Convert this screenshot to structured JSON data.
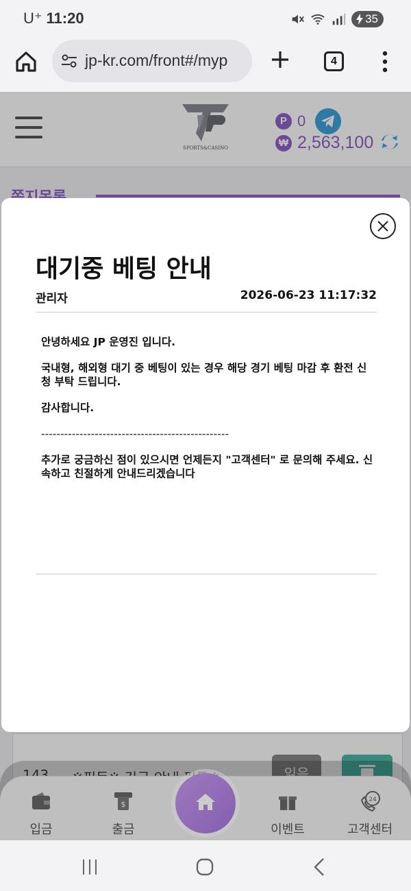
{
  "status_bar": {
    "carrier": "U⁺",
    "time": "11:20",
    "battery": "35"
  },
  "browser": {
    "url": "jp-kr.com/front#/myp",
    "tab_count": "4"
  },
  "site_header": {
    "logo_tagline": "SPORTS&CASINO",
    "points_badge": "P",
    "points": "0",
    "won_badge": "₩",
    "balance": "2,563,100"
  },
  "background": {
    "section_title": "쪽지목록",
    "row": {
      "number": "143",
      "title": "※필독※ 긴급 안내 필독※",
      "read_label": "읽음"
    }
  },
  "modal": {
    "title": "대기중 베팅 안내",
    "author": "관리자",
    "datetime": "2026-06-23 11:17:32",
    "paragraphs": [
      "안녕하세요 JP 운영진 입니다.",
      "국내형, 해외형 대기 중 베팅이 있는 경우 해당 경기 베팅 마감 후 환전 신청 부탁 드립니다.",
      "감사합니다.",
      "-------------------------------------------------",
      "추가로 궁금하신 점이 있으시면 언제든지 \"고객센터\" 로 문의해 주세요. 신속하고 친절하게 안내드리겠습니다"
    ]
  },
  "bottom_nav": {
    "deposit": "입금",
    "withdraw": "출금",
    "event": "이벤트",
    "support": "고객센터",
    "support_badge": "24"
  },
  "colors": {
    "accent": "#8e62c9",
    "teal": "#4cb9a7"
  }
}
